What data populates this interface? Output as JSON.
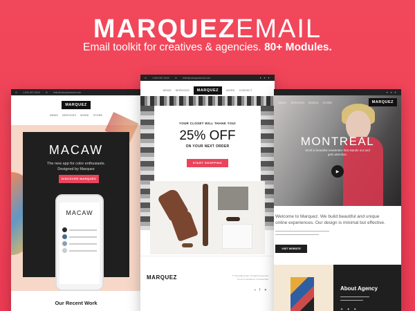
{
  "hero": {
    "title_bold": "MARQUEZ",
    "title_thin": "EMAIL",
    "subtitle_plain": "Email toolkit for creatives & agencies.",
    "subtitle_bold": "80+ Modules."
  },
  "left_card": {
    "topbar_phone": "1-800-987-6543",
    "topbar_email": "hello@marquezemail.com",
    "logo": "MARQUEZ",
    "nav": [
      "NEWS",
      "SERVICES",
      "WORK",
      "STORE"
    ],
    "headline": "MACAW",
    "description_line1": "The new app for color enthusiasts.",
    "description_line2": "Designed by Marquez",
    "cta": "DISCOVER MARQUEZ",
    "phone_logo": "MACAW",
    "section_title": "Our Recent Work"
  },
  "center_card": {
    "topbar_phone": "1-800-987-6543",
    "topbar_email": "hello@marquezemail.com",
    "nav_left": [
      "NEWS",
      "SERVICES"
    ],
    "logo": "MARQUEZ",
    "nav_right": [
      "WORK",
      "CONTACT"
    ],
    "promo_line": "YOUR CLOSET WILL THANK YOU!",
    "offer": "25% OFF",
    "offer_sub": "ON YOUR NEXT ORDER",
    "cta": "START SHOPPING",
    "footer_logo": "MARQUEZ",
    "footer_fine_1": "© ThemeMountain, All Rights Reserved",
    "footer_fine_2": "Terms & Conditions | Unsubscribe"
  },
  "right_card": {
    "nav": [
      "NEWS",
      "SERVICES",
      "BOOKS",
      "STORE"
    ],
    "logo": "MARQUEZ",
    "headline": "MONTREAL",
    "headline_sub": "Stroll a beautiful newsletter that stands out and gets attention.",
    "welcome": "Welcome to Marquez. We build beautiful and unique online experiences. Our design is minimal but effective.",
    "cta": "VISIT WEBSITE",
    "about_title": "About Agency"
  }
}
